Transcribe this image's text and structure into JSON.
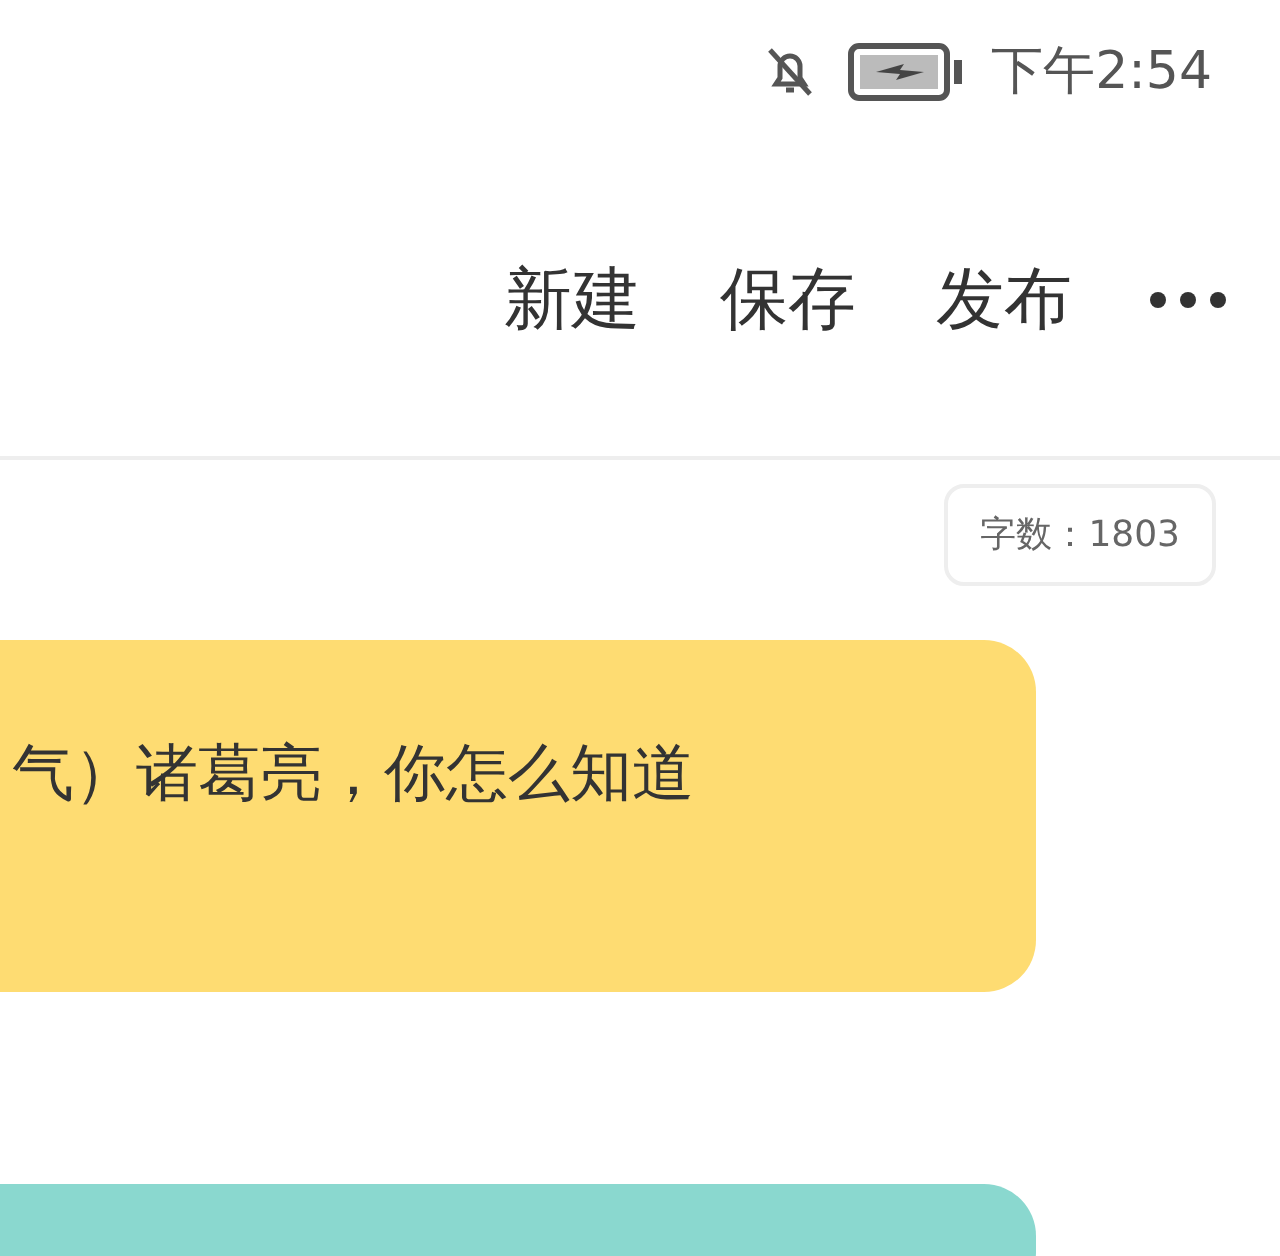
{
  "status_bar": {
    "time": "下午2:54"
  },
  "toolbar": {
    "actions": [
      "新建",
      "保存",
      "发布"
    ]
  },
  "word_count": "字数：1803",
  "cards": [
    {
      "text": "气）诸葛亮，你怎么知道",
      "color": "#fedc72"
    },
    {
      "color": "#8ad8cf"
    }
  ]
}
